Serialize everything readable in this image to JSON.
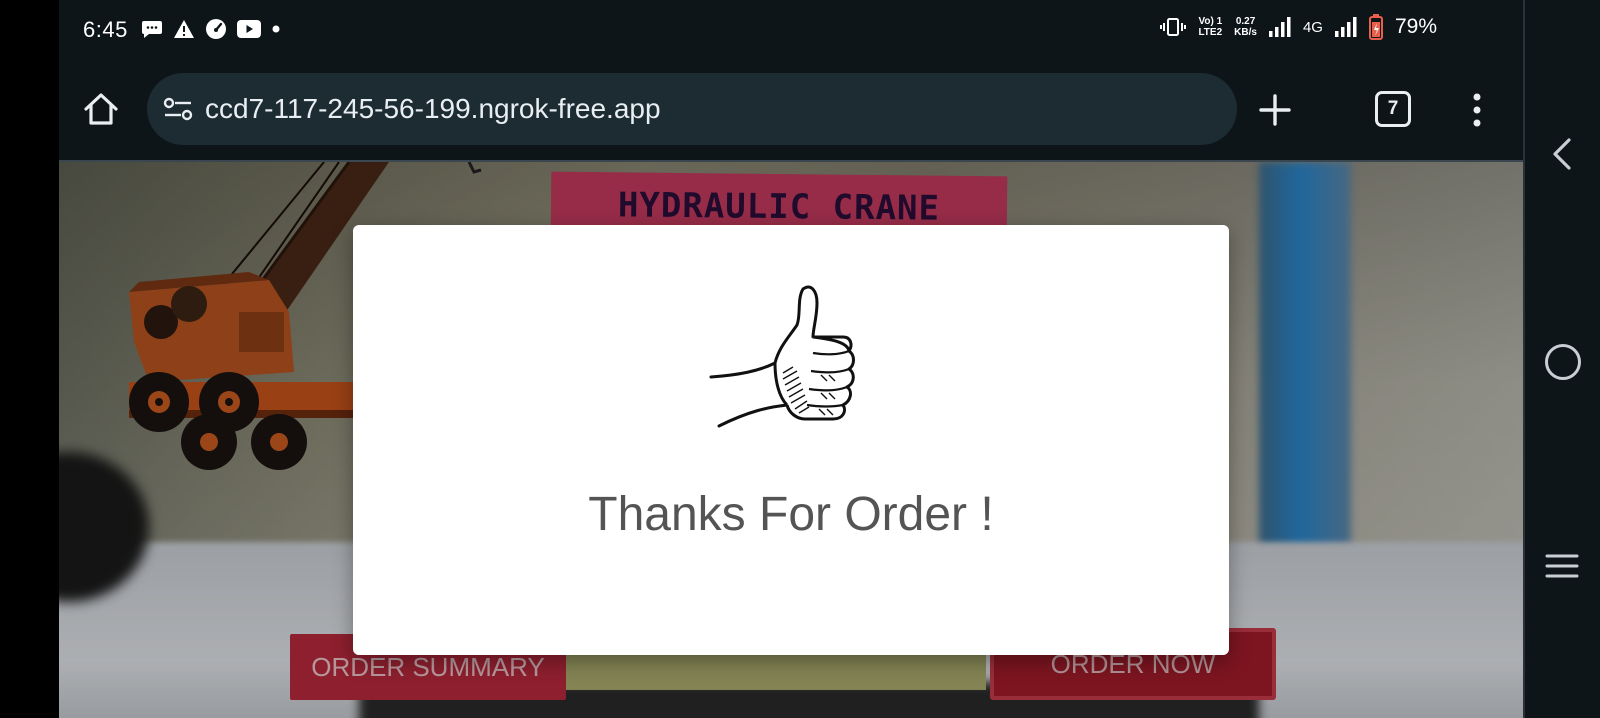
{
  "status_bar": {
    "time": "6:45",
    "left_icons": [
      "chat-icon",
      "alert-icon",
      "speed-icon",
      "youtube-icon",
      "dot-icon"
    ],
    "net_line1": "Vo) 1",
    "net_line2": "LTE2",
    "speed_value": "0.27",
    "speed_unit": "KB/s",
    "network_type": "4G",
    "battery_percent": "79%"
  },
  "browser": {
    "url": "ccd7-117-245-56-199.ngrok-free.app",
    "tab_count": "7"
  },
  "scene": {
    "product_title": "HYDRAULIC CRANE"
  },
  "actions": {
    "order_summary_label": "ORDER SUMMARY",
    "order_now_label": "ORDER NOW"
  },
  "modal": {
    "message": "Thanks For Order !"
  },
  "colors": {
    "title_banner": "#c1395d",
    "order_button": "#b5283c",
    "middle_bar": "#a8a86c",
    "bar_background": "#0d1519"
  }
}
